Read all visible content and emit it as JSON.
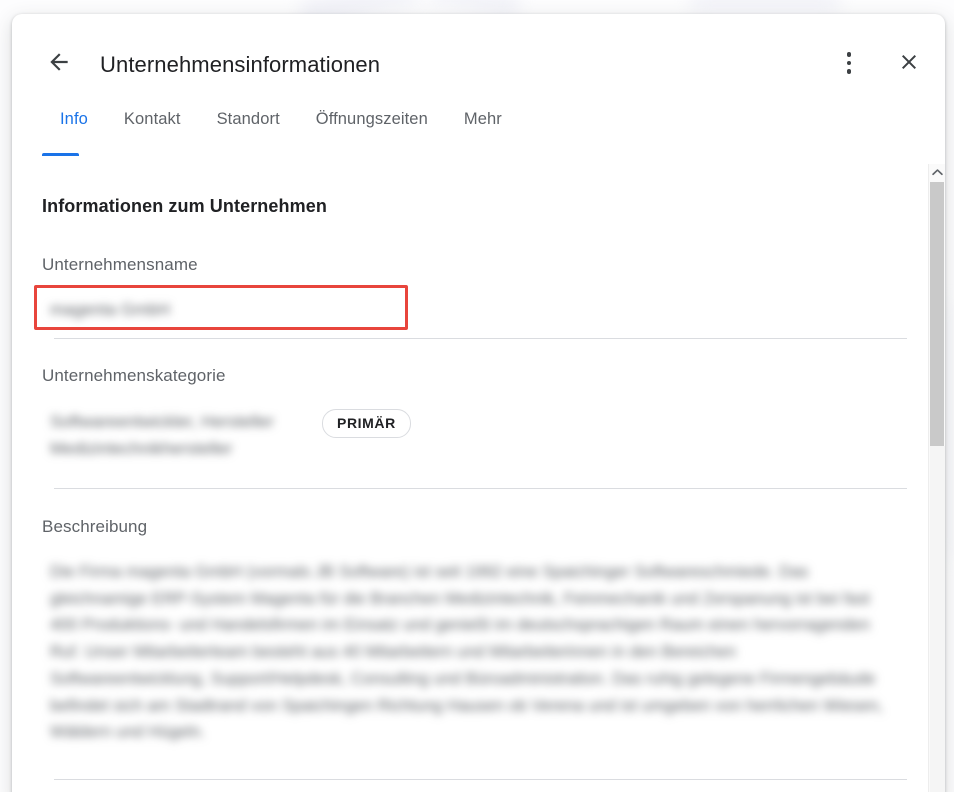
{
  "header": {
    "title": "Unternehmensinformationen",
    "back_label": "Zurück",
    "more_label": "Weitere Optionen",
    "close_label": "Schließen"
  },
  "tabs": [
    {
      "label": "Info",
      "active": true
    },
    {
      "label": "Kontakt",
      "active": false
    },
    {
      "label": "Standort",
      "active": false
    },
    {
      "label": "Öffnungszeiten",
      "active": false
    },
    {
      "label": "Mehr",
      "active": false
    }
  ],
  "main": {
    "section_title": "Informationen zum Unternehmen",
    "fields": {
      "name": {
        "label": "Unternehmensname",
        "value": "magenta GmbH",
        "redacted": true,
        "highlighted": true
      },
      "category": {
        "label": "Unternehmenskategorie",
        "value": "Softwareentwickler, Hersteller Medizintechnikhersteller",
        "redacted": true,
        "badge": "PRIMÄR"
      },
      "description": {
        "label": "Beschreibung",
        "value": "Die Firma magenta GmbH (vormals JB Software) ist seit 1992 eine Spaichinger Softwareschmiede. Das gleichnamige ERP-System Magenta für die Branchen Medizintechnik, Feinmechanik und Zerspanung ist bei fast 400 Produktions- und Handelsfirmen im Einsatz und genießt im deutschsprachigen Raum einen hervorragenden Ruf. Unser Mitarbeiterteam besteht aus 40 Mitarbeitern und Mitarbeiterinnen in den Bereichen Softwareentwicklung, Support/Helpdesk, Consulting und Büroadministration. Das ruhig gelegene Firmengebäude befindet sich am Stadtrand von Spaichingen Richtung Hausen ob Verena und ist umgeben von herrlichen Wiesen, Wäldern und Hügeln.",
        "redacted": true
      }
    }
  },
  "scrollbar": {
    "up_arrow": "chevron-up-icon",
    "position_percent": 0
  },
  "colors": {
    "accent": "#1a73e8",
    "annotation": "#e8453c",
    "text_primary": "#202124",
    "text_secondary": "#5f6368",
    "divider": "#dadce0"
  }
}
